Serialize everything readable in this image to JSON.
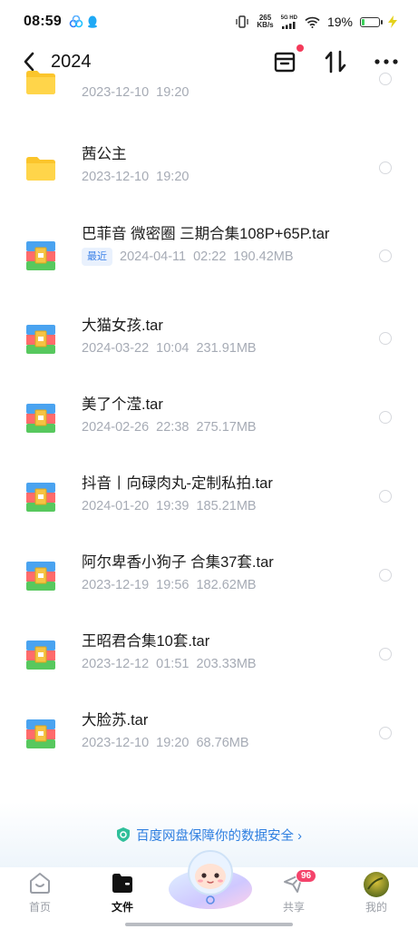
{
  "status_bar": {
    "time": "08:59",
    "net_speed_value": "265",
    "net_speed_unit": "KB/s",
    "network_label": "5G HD",
    "battery_percent": "19%",
    "battery_level": 0.19
  },
  "header": {
    "title": "2024"
  },
  "files": [
    {
      "name": "",
      "date": "2023-12-10",
      "time": "19:20",
      "size": "",
      "type": "folder",
      "recent": false
    },
    {
      "name": "茜公主",
      "date": "2023-12-10",
      "time": "19:20",
      "size": "",
      "type": "folder",
      "recent": false
    },
    {
      "name": "巴菲音 微密圈 三期合集108P+65P.tar",
      "date": "2024-04-11",
      "time": "02:22",
      "size": "190.42MB",
      "type": "archive",
      "recent": true
    },
    {
      "name": "大猫女孩.tar",
      "date": "2024-03-22",
      "time": "10:04",
      "size": "231.91MB",
      "type": "archive",
      "recent": false
    },
    {
      "name": "美了个滢.tar",
      "date": "2024-02-26",
      "time": "22:38",
      "size": "275.17MB",
      "type": "archive",
      "recent": false
    },
    {
      "name": "抖音丨向碌肉丸-定制私拍.tar",
      "date": "2024-01-20",
      "time": "19:39",
      "size": "185.21MB",
      "type": "archive",
      "recent": false
    },
    {
      "name": "阿尔卑香小狗子 合集37套.tar",
      "date": "2023-12-19",
      "time": "19:56",
      "size": "182.62MB",
      "type": "archive",
      "recent": false
    },
    {
      "name": "王昭君合集10套.tar",
      "date": "2023-12-12",
      "time": "01:51",
      "size": "203.33MB",
      "type": "archive",
      "recent": false
    },
    {
      "name": "大脸苏.tar",
      "date": "2023-12-10",
      "time": "19:20",
      "size": "68.76MB",
      "type": "archive",
      "recent": false
    }
  ],
  "recent_badge": "最近",
  "security_banner": {
    "text": "百度网盘保障你的数据安全 ›"
  },
  "bottom_nav": {
    "items": [
      {
        "label": "首页",
        "icon": "home-icon",
        "active": false
      },
      {
        "label": "文件",
        "icon": "folder-icon",
        "active": true
      },
      {
        "label": "共享",
        "icon": "share-icon",
        "active": false,
        "badge": "96"
      },
      {
        "label": "我的",
        "icon": "avatar",
        "active": false
      }
    ]
  },
  "colors": {
    "accent": "#2f7fe0",
    "badge_red": "#f4436b",
    "meta_gray": "#a6abb5"
  }
}
